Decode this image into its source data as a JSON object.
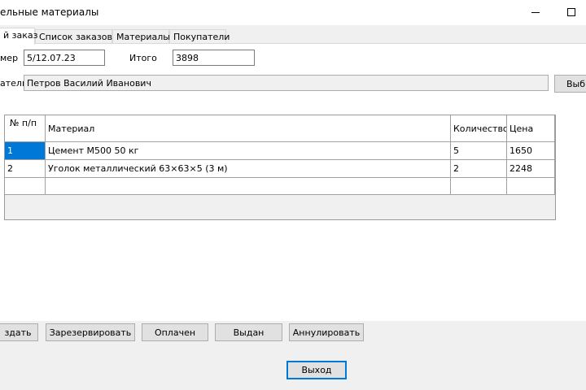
{
  "window": {
    "title": "ельные материалы"
  },
  "tabs": [
    {
      "label": "й заказ",
      "active": true
    },
    {
      "label": "Список заказов",
      "active": false
    },
    {
      "label": "Материалы",
      "active": false
    },
    {
      "label": "Покупатели",
      "active": false
    }
  ],
  "form": {
    "number_label": "мер",
    "number_value": "5/12.07.23",
    "total_label": "Итого",
    "total_value": "3898",
    "buyer_label": "атель",
    "buyer_value": "Петров Василий Иванович",
    "select_button": "Выбр"
  },
  "table": {
    "headers": [
      "№ п/п",
      "Материал",
      "Количество",
      "Цена"
    ],
    "rows": [
      [
        "1",
        "Цемент М500 50 кг",
        "5",
        "1650"
      ],
      [
        "2",
        "Уголок металлический 63×63×5 (3 м)",
        "2",
        "2248"
      ]
    ]
  },
  "actions": {
    "create": "здать",
    "reserve": "Зарезервировать",
    "paid": "Оплачен",
    "issued": "Выдан",
    "cancel": "Аннулировать",
    "exit": "Выход"
  }
}
